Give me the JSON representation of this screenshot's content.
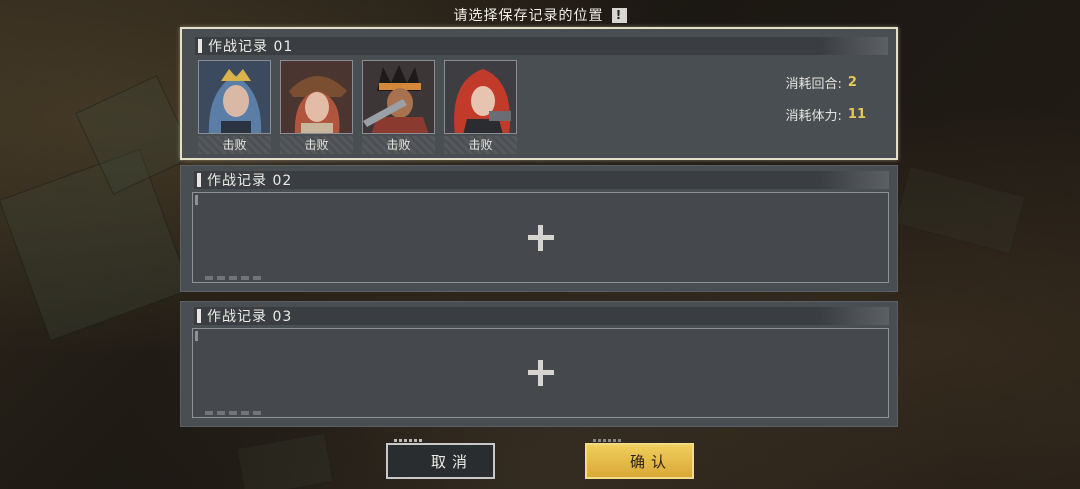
{
  "header": {
    "title": "请选择保存记录的位置",
    "info_glyph": "!"
  },
  "slots": [
    {
      "title": "作战记录 01",
      "selected": true,
      "characters": [
        {
          "status": "击败",
          "accent": "#5b7ea6"
        },
        {
          "status": "击败",
          "accent": "#b0553e"
        },
        {
          "status": "击败",
          "accent": "#8a3a2e"
        },
        {
          "status": "击败",
          "accent": "#c13a2a"
        }
      ],
      "stats": {
        "turns_label": "消耗回合:",
        "turns_value": "2",
        "stamina_label": "消耗体力:",
        "stamina_value": "11"
      }
    },
    {
      "title": "作战记录 02",
      "selected": false,
      "empty": true
    },
    {
      "title": "作战记录 03",
      "selected": false,
      "empty": true
    }
  ],
  "buttons": {
    "cancel": "取消",
    "confirm": "确认"
  },
  "colors": {
    "accent_yellow": "#e7c75a",
    "panel": "#494e52",
    "confirm_button": "#f0ce5c"
  }
}
